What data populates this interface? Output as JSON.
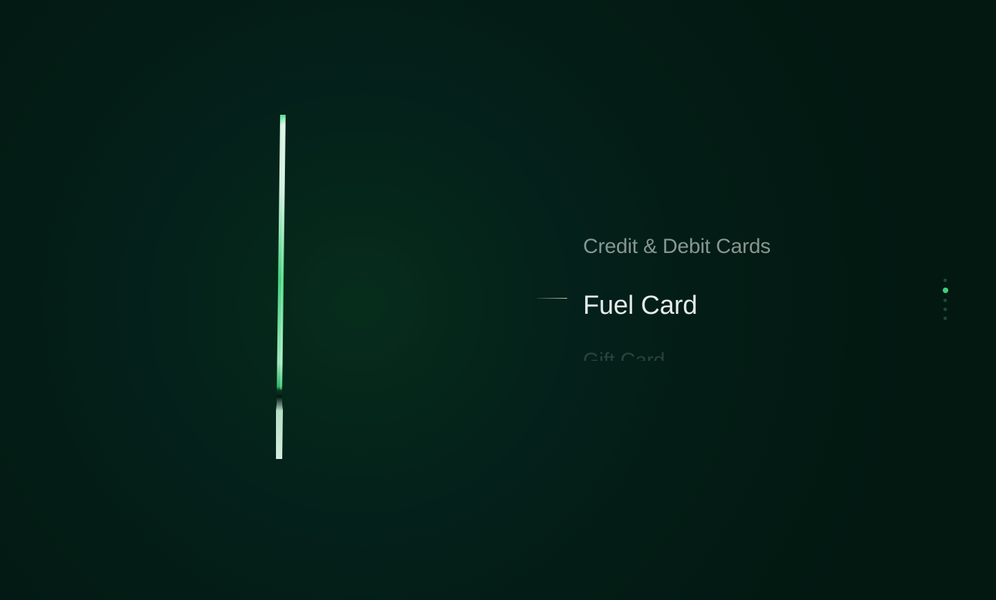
{
  "card_types": {
    "previous": "Credit & Debit Cards",
    "active": "Fuel Card",
    "next": "Gift Card"
  },
  "pagination": {
    "total": 5,
    "active_index": 1
  },
  "colors": {
    "background": "#021811",
    "accent": "#3fd07a",
    "text_active": "#e3ebe7"
  }
}
